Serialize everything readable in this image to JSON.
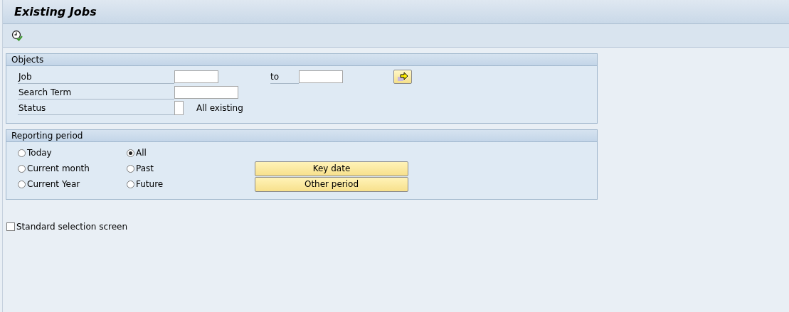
{
  "window": {
    "title": "Existing Jobs"
  },
  "objects": {
    "title": "Objects",
    "job": {
      "label": "Job",
      "to_label": "to"
    },
    "search_term": {
      "label": "Search Term"
    },
    "status": {
      "label": "Status",
      "text": "All existing"
    }
  },
  "reporting_period": {
    "title": "Reporting period",
    "options": [
      {
        "label": "Today",
        "selected": false
      },
      {
        "label": "All",
        "selected": true
      },
      {
        "label": "Current month",
        "selected": false
      },
      {
        "label": "Past",
        "selected": false
      },
      {
        "label": "Current Year",
        "selected": false
      },
      {
        "label": "Future",
        "selected": false
      }
    ],
    "buttons": [
      "Key date",
      "Other period"
    ]
  },
  "standard_selection": {
    "label": "Standard selection screen",
    "checked": false
  }
}
